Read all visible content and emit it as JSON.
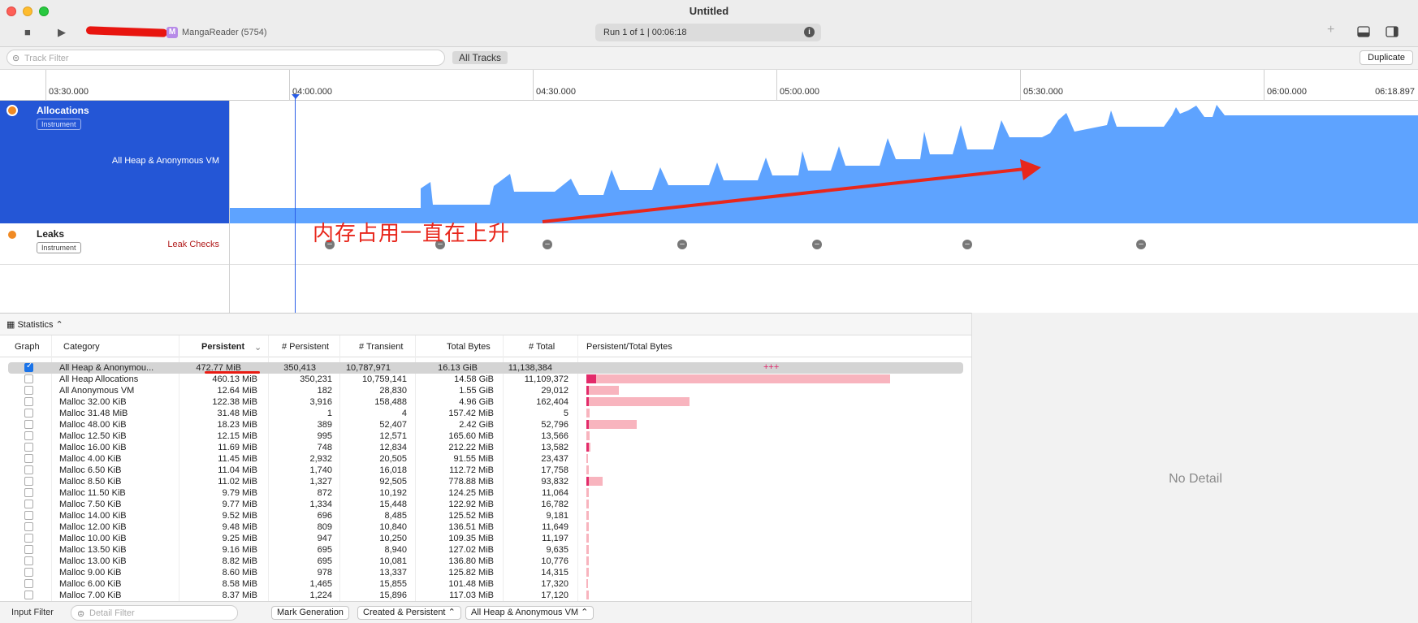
{
  "window": {
    "title": "Untitled"
  },
  "toolbar": {
    "target_badge": "M",
    "target_name": "MangaReader (5754)",
    "run": "Run 1 of 1  |  00:06:18",
    "info_icon": "i"
  },
  "filter": {
    "placeholder": "Track Filter",
    "all_tracks": "All Tracks",
    "duplicate": "Duplicate"
  },
  "ruler": {
    "ticks": [
      "03:30.000",
      "04:00.000",
      "04:30.000",
      "05:00.000",
      "05:30.000",
      "06:00.000"
    ],
    "end": "06:18.897"
  },
  "tracks": {
    "allocations": {
      "title": "Allocations",
      "badge": "Instrument",
      "label": "All Heap & Anonymous VM"
    },
    "leaks": {
      "title": "Leaks",
      "badge": "Instrument",
      "label": "Leak Checks"
    }
  },
  "annotation": "内存占用一直在上升",
  "stats": {
    "mode": "Statistics",
    "columns": [
      "Graph",
      "Category",
      "Persistent",
      "# Persistent",
      "# Transient",
      "Total Bytes",
      "# Total",
      "Persistent/Total Bytes"
    ],
    "rows": [
      {
        "checked": true,
        "category": "All Heap & Anonymou...",
        "persistent": "472.77 MiB",
        "n_persistent": "350,413",
        "n_transient": "10,787,971",
        "total_bytes": "16.13 GiB",
        "n_total": "11,138,384",
        "bar": 0,
        "mark": "+++"
      },
      {
        "checked": false,
        "category": "All Heap Allocations",
        "persistent": "460.13 MiB",
        "n_persistent": "350,231",
        "n_transient": "10,759,141",
        "total_bytes": "14.58 GiB",
        "n_total": "11,109,372",
        "bar": 0.9
      },
      {
        "checked": false,
        "category": "All Anonymous VM",
        "persistent": "12.64 MiB",
        "n_persistent": "182",
        "n_transient": "28,830",
        "total_bytes": "1.55 GiB",
        "n_total": "29,012",
        "bar": 0.096
      },
      {
        "checked": false,
        "category": "Malloc 32.00 KiB",
        "persistent": "122.38 MiB",
        "n_persistent": "3,916",
        "n_transient": "158,488",
        "total_bytes": "4.96 GiB",
        "n_total": "162,404",
        "bar": 0.307
      },
      {
        "checked": false,
        "category": "Malloc 31.48 MiB",
        "persistent": "31.48 MiB",
        "n_persistent": "1",
        "n_transient": "4",
        "total_bytes": "157.42 MiB",
        "n_total": "5",
        "bar": 0.01
      },
      {
        "checked": false,
        "category": "Malloc 48.00 KiB",
        "persistent": "18.23 MiB",
        "n_persistent": "389",
        "n_transient": "52,407",
        "total_bytes": "2.42 GiB",
        "n_total": "52,796",
        "bar": 0.15
      },
      {
        "checked": false,
        "category": "Malloc 12.50 KiB",
        "persistent": "12.15 MiB",
        "n_persistent": "995",
        "n_transient": "12,571",
        "total_bytes": "165.60 MiB",
        "n_total": "13,566",
        "bar": 0.01
      },
      {
        "checked": false,
        "category": "Malloc 16.00 KiB",
        "persistent": "11.69 MiB",
        "n_persistent": "748",
        "n_transient": "12,834",
        "total_bytes": "212.22 MiB",
        "n_total": "13,582",
        "bar": 0.013
      },
      {
        "checked": false,
        "category": "Malloc 4.00 KiB",
        "persistent": "11.45 MiB",
        "n_persistent": "2,932",
        "n_transient": "20,505",
        "total_bytes": "91.55 MiB",
        "n_total": "23,437",
        "bar": 0.006
      },
      {
        "checked": false,
        "category": "Malloc 6.50 KiB",
        "persistent": "11.04 MiB",
        "n_persistent": "1,740",
        "n_transient": "16,018",
        "total_bytes": "112.72 MiB",
        "n_total": "17,758",
        "bar": 0.007
      },
      {
        "checked": false,
        "category": "Malloc 8.50 KiB",
        "persistent": "11.02 MiB",
        "n_persistent": "1,327",
        "n_transient": "92,505",
        "total_bytes": "778.88 MiB",
        "n_total": "93,832",
        "bar": 0.047
      },
      {
        "checked": false,
        "category": "Malloc 11.50 KiB",
        "persistent": "9.79 MiB",
        "n_persistent": "872",
        "n_transient": "10,192",
        "total_bytes": "124.25 MiB",
        "n_total": "11,064",
        "bar": 0.008
      },
      {
        "checked": false,
        "category": "Malloc 7.50 KiB",
        "persistent": "9.77 MiB",
        "n_persistent": "1,334",
        "n_transient": "15,448",
        "total_bytes": "122.92 MiB",
        "n_total": "16,782",
        "bar": 0.008
      },
      {
        "checked": false,
        "category": "Malloc 14.00 KiB",
        "persistent": "9.52 MiB",
        "n_persistent": "696",
        "n_transient": "8,485",
        "total_bytes": "125.52 MiB",
        "n_total": "9,181",
        "bar": 0.008
      },
      {
        "checked": false,
        "category": "Malloc 12.00 KiB",
        "persistent": "9.48 MiB",
        "n_persistent": "809",
        "n_transient": "10,840",
        "total_bytes": "136.51 MiB",
        "n_total": "11,649",
        "bar": 0.008
      },
      {
        "checked": false,
        "category": "Malloc 10.00 KiB",
        "persistent": "9.25 MiB",
        "n_persistent": "947",
        "n_transient": "10,250",
        "total_bytes": "109.35 MiB",
        "n_total": "11,197",
        "bar": 0.007
      },
      {
        "checked": false,
        "category": "Malloc 13.50 KiB",
        "persistent": "9.16 MiB",
        "n_persistent": "695",
        "n_transient": "8,940",
        "total_bytes": "127.02 MiB",
        "n_total": "9,635",
        "bar": 0.008
      },
      {
        "checked": false,
        "category": "Malloc 13.00 KiB",
        "persistent": "8.82 MiB",
        "n_persistent": "695",
        "n_transient": "10,081",
        "total_bytes": "136.80 MiB",
        "n_total": "10,776",
        "bar": 0.008
      },
      {
        "checked": false,
        "category": "Malloc 9.00 KiB",
        "persistent": "8.60 MiB",
        "n_persistent": "978",
        "n_transient": "13,337",
        "total_bytes": "125.82 MiB",
        "n_total": "14,315",
        "bar": 0.008
      },
      {
        "checked": false,
        "category": "Malloc 6.00 KiB",
        "persistent": "8.58 MiB",
        "n_persistent": "1,465",
        "n_transient": "15,855",
        "total_bytes": "101.48 MiB",
        "n_total": "17,320",
        "bar": 0.006
      },
      {
        "checked": false,
        "category": "Malloc 7.00 KiB",
        "persistent": "8.37 MiB",
        "n_persistent": "1,224",
        "n_transient": "15,896",
        "total_bytes": "117.03 MiB",
        "n_total": "17,120",
        "bar": 0.007
      }
    ]
  },
  "detail": {
    "empty": "No Detail"
  },
  "bottom": {
    "input_filter": "Input Filter",
    "detail_filter_placeholder": "Detail Filter",
    "mark_generation": "Mark Generation",
    "mode": "Created & Persistent",
    "scope": "All Heap & Anonymous VM"
  },
  "colors": {
    "graph_fill": "#5ea3ff",
    "track_selected": "#2456d6",
    "annotation": "#e8271c"
  }
}
